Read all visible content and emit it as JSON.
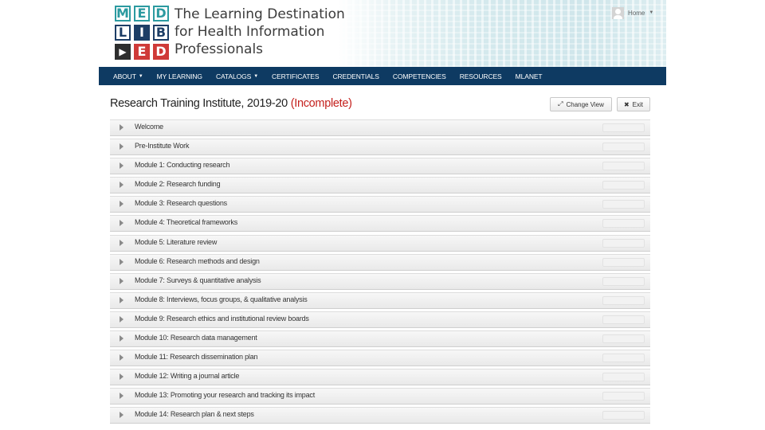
{
  "header": {
    "logo": {
      "rows": [
        [
          "M",
          "E",
          "D"
        ],
        [
          "L",
          "I",
          "B"
        ],
        [
          "play",
          "E",
          "D"
        ]
      ]
    },
    "tagline": [
      "The Learning Destination",
      "for Health Information",
      "Professionals"
    ],
    "user": {
      "name": "Home",
      "avatar_icon": "user-avatar-icon"
    }
  },
  "nav": {
    "items": [
      {
        "label": "ABOUT",
        "dropdown": true
      },
      {
        "label": "MY LEARNING",
        "dropdown": false
      },
      {
        "label": "CATALOGS",
        "dropdown": true
      },
      {
        "label": "CERTIFICATES",
        "dropdown": false
      },
      {
        "label": "CREDENTIALS",
        "dropdown": false
      },
      {
        "label": "COMPETENCIES",
        "dropdown": false
      },
      {
        "label": "RESOURCES",
        "dropdown": false
      },
      {
        "label": "MLANET",
        "dropdown": false
      }
    ]
  },
  "page": {
    "title": "Research Training Institute, 2019-20",
    "status": "(Incomplete)",
    "change_view_label": "Change View",
    "exit_label": "Exit"
  },
  "modules": [
    "Welcome",
    "Pre-Institute Work",
    "Module 1: Conducting research",
    "Module 2: Research funding",
    "Module 3: Research questions",
    "Module 4: Theoretical frameworks",
    "Module 5: Literature review",
    "Module 6: Research methods and design",
    "Module 7: Surveys & quantitative analysis",
    "Module 8: Interviews, focus groups, & qualitative analysis",
    "Module 9: Research ethics and institutional review boards",
    "Module 10: Research data management",
    "Module 11: Research dissemination plan",
    "Module 12: Writing a journal article",
    "Module 13: Promoting your research and tracking its impact",
    "Module 14: Research plan & next steps"
  ],
  "colors": {
    "navbar": "#0e3a62",
    "status_incomplete": "#c4201d",
    "logo_teal": "#2b9aa0",
    "logo_navy": "#1d3e66",
    "logo_red": "#cf3a38"
  }
}
